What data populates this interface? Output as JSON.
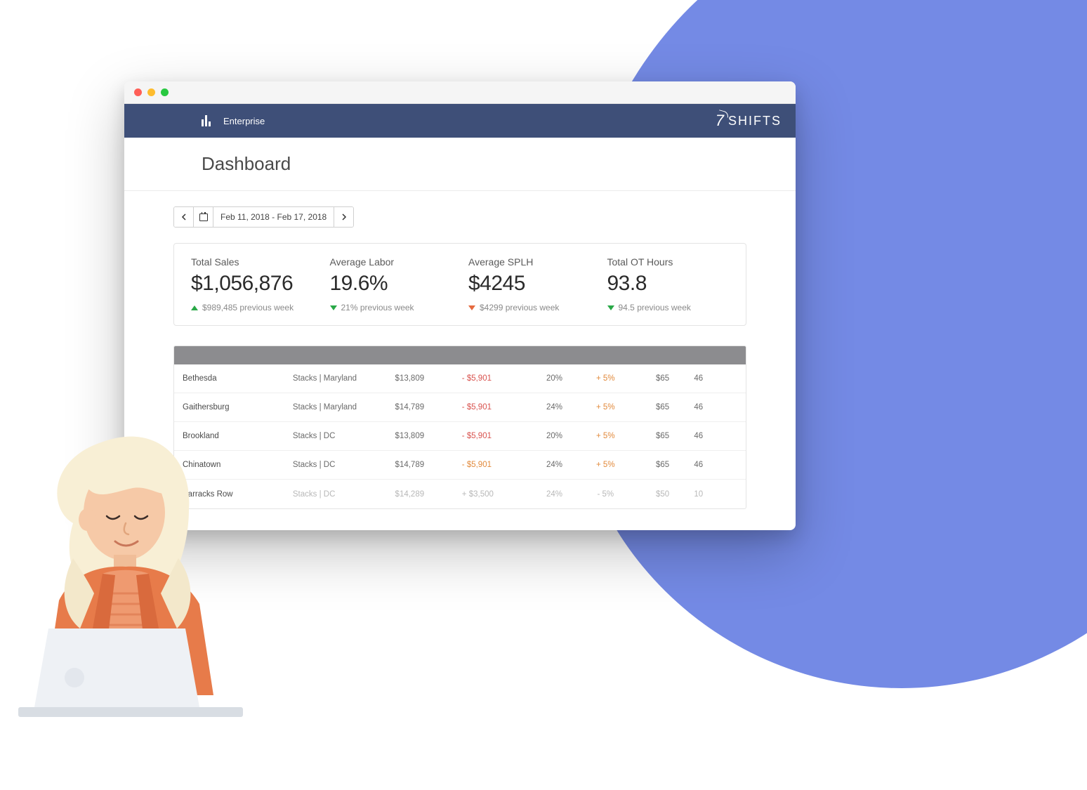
{
  "header": {
    "nav_label": "Enterprise",
    "brand_text": "SHIFTS",
    "brand_mark": "7"
  },
  "page_title": "Dashboard",
  "date_picker": {
    "range_text": "Feb 11, 2018 - Feb 17, 2018"
  },
  "metrics": [
    {
      "label": "Total Sales",
      "value": "$1,056,876",
      "trend": "up",
      "prev": "$989,485 previous week"
    },
    {
      "label": "Average Labor",
      "value": "19.6%",
      "trend": "down",
      "prev": "21% previous week"
    },
    {
      "label": "Average SPLH",
      "value": "$4245",
      "trend": "down_red",
      "prev": "$4299 previous week"
    },
    {
      "label": "Total OT Hours",
      "value": "93.8",
      "trend": "down",
      "prev": "94.5 previous week"
    }
  ],
  "table": {
    "rows": [
      {
        "location": "Bethesda",
        "group": "Stacks | Maryland",
        "sales": "$13,809",
        "delta_sales": "- $5,901",
        "delta_style": "red",
        "labor": "20%",
        "delta_labor": "+ 5%",
        "dl_style": "orange",
        "splh": "$65",
        "ot": "46"
      },
      {
        "location": "Gaithersburg",
        "group": "Stacks | Maryland",
        "sales": "$14,789",
        "delta_sales": "- $5,901",
        "delta_style": "red",
        "labor": "24%",
        "delta_labor": "+ 5%",
        "dl_style": "orange",
        "splh": "$65",
        "ot": "46"
      },
      {
        "location": "Brookland",
        "group": "Stacks | DC",
        "sales": "$13,809",
        "delta_sales": "- $5,901",
        "delta_style": "red",
        "labor": "20%",
        "delta_labor": "+ 5%",
        "dl_style": "orange",
        "splh": "$65",
        "ot": "46"
      },
      {
        "location": "Chinatown",
        "group": "Stacks | DC",
        "sales": "$14,789",
        "delta_sales": "- $5,901",
        "delta_style": "orange",
        "labor": "24%",
        "delta_labor": "+ 5%",
        "dl_style": "orange",
        "splh": "$65",
        "ot": "46"
      },
      {
        "location": "Barracks Row",
        "group": "Stacks | DC",
        "sales": "$14,289",
        "delta_sales": "+ $3,500",
        "delta_style": "muted",
        "labor": "24%",
        "delta_labor": "- 5%",
        "dl_style": "muted",
        "splh": "$50",
        "ot": "10"
      }
    ]
  }
}
